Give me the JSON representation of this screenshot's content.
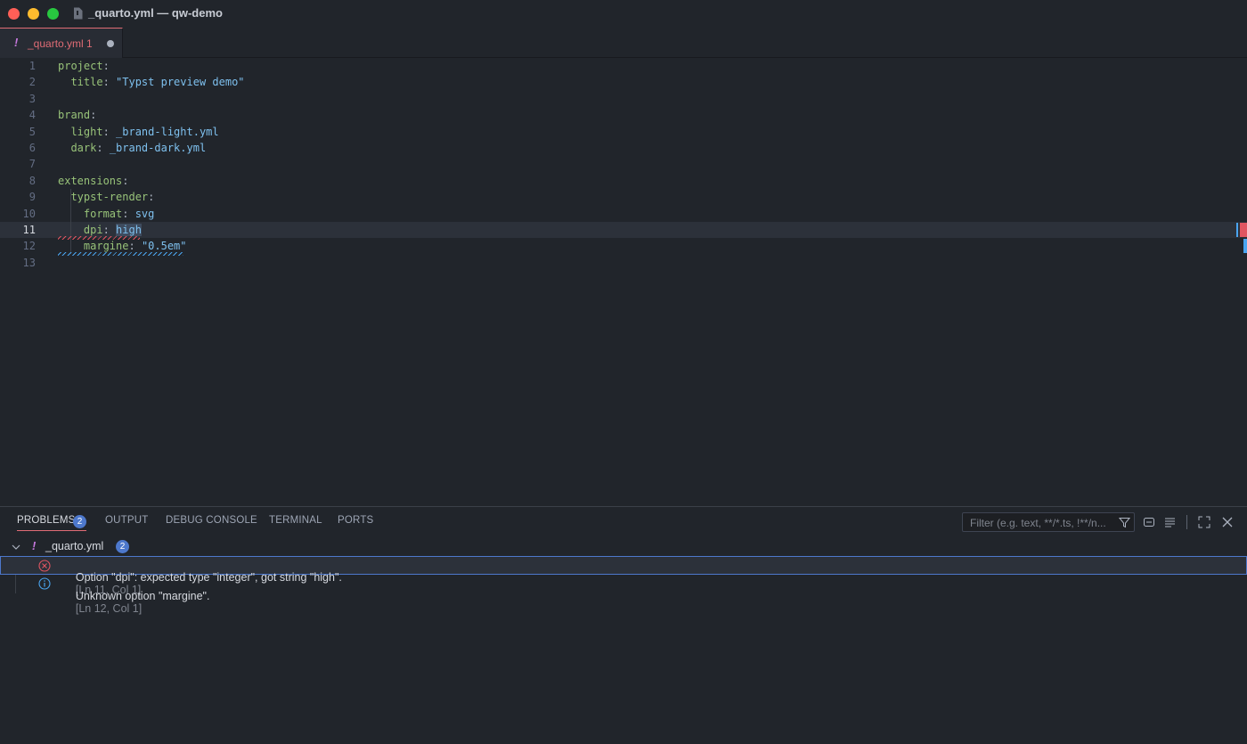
{
  "window": {
    "title": "_quarto.yml — qw-demo"
  },
  "tab": {
    "warn_glyph": "!",
    "label": "_quarto.yml 1"
  },
  "editor": {
    "lines": [
      {
        "n": "1",
        "tokens": [
          {
            "t": "project",
            "c": "k"
          },
          {
            "t": ":",
            "c": "p"
          }
        ]
      },
      {
        "n": "2",
        "tokens": [
          {
            "t": "  title",
            "c": "k"
          },
          {
            "t": ": ",
            "c": "p"
          },
          {
            "t": "\"Typst preview demo\"",
            "c": "s"
          }
        ]
      },
      {
        "n": "3",
        "tokens": []
      },
      {
        "n": "4",
        "tokens": [
          {
            "t": "brand",
            "c": "k"
          },
          {
            "t": ":",
            "c": "p"
          }
        ]
      },
      {
        "n": "5",
        "tokens": [
          {
            "t": "  light",
            "c": "k"
          },
          {
            "t": ": ",
            "c": "p"
          },
          {
            "t": "_brand-light.yml",
            "c": "s"
          }
        ]
      },
      {
        "n": "6",
        "tokens": [
          {
            "t": "  dark",
            "c": "k"
          },
          {
            "t": ": ",
            "c": "p"
          },
          {
            "t": "_brand-dark.yml",
            "c": "s"
          }
        ]
      },
      {
        "n": "7",
        "tokens": []
      },
      {
        "n": "8",
        "tokens": [
          {
            "t": "extensions",
            "c": "k"
          },
          {
            "t": ":",
            "c": "p"
          }
        ]
      },
      {
        "n": "9",
        "tokens": [
          {
            "t": "  typst-render",
            "c": "k"
          },
          {
            "t": ":",
            "c": "p"
          }
        ]
      },
      {
        "n": "10",
        "tokens": [
          {
            "t": "    format",
            "c": "k"
          },
          {
            "t": ": ",
            "c": "p"
          },
          {
            "t": "svg",
            "c": "s"
          }
        ]
      },
      {
        "n": "11",
        "tokens": [
          {
            "t": "    dpi",
            "c": "k"
          },
          {
            "t": ": ",
            "c": "p"
          },
          {
            "t": "high",
            "c": "s sel"
          }
        ]
      },
      {
        "n": "12",
        "tokens": [
          {
            "t": "    margine",
            "c": "k"
          },
          {
            "t": ": ",
            "c": "p"
          },
          {
            "t": "\"0.5em\"",
            "c": "s"
          }
        ]
      },
      {
        "n": "13",
        "tokens": []
      }
    ],
    "current_line": "11"
  },
  "panel": {
    "tabs": [
      {
        "label": "PROBLEMS",
        "active": true
      },
      {
        "label": "OUTPUT",
        "active": false
      },
      {
        "label": "DEBUG CONSOLE",
        "active": false
      },
      {
        "label": "TERMINAL",
        "active": false
      },
      {
        "label": "PORTS",
        "active": false
      }
    ],
    "problems_count": "2",
    "filter_placeholder": "Filter (e.g. text, **/*.ts, !**/n...",
    "file": {
      "warn_glyph": "!",
      "name": "_quarto.yml",
      "count": "2"
    },
    "problems": [
      {
        "severity": "error",
        "message": "Option \"dpi\": expected type \"integer\", got string \"high\".",
        "location": "[Ln 11, Col 1]"
      },
      {
        "severity": "info",
        "message": "Unknown option \"margine\".",
        "location": "[Ln 12, Col 1]"
      }
    ]
  },
  "colors": {
    "error": "#e05561",
    "info": "#4aa5f0",
    "accent": "#4d78cc"
  }
}
